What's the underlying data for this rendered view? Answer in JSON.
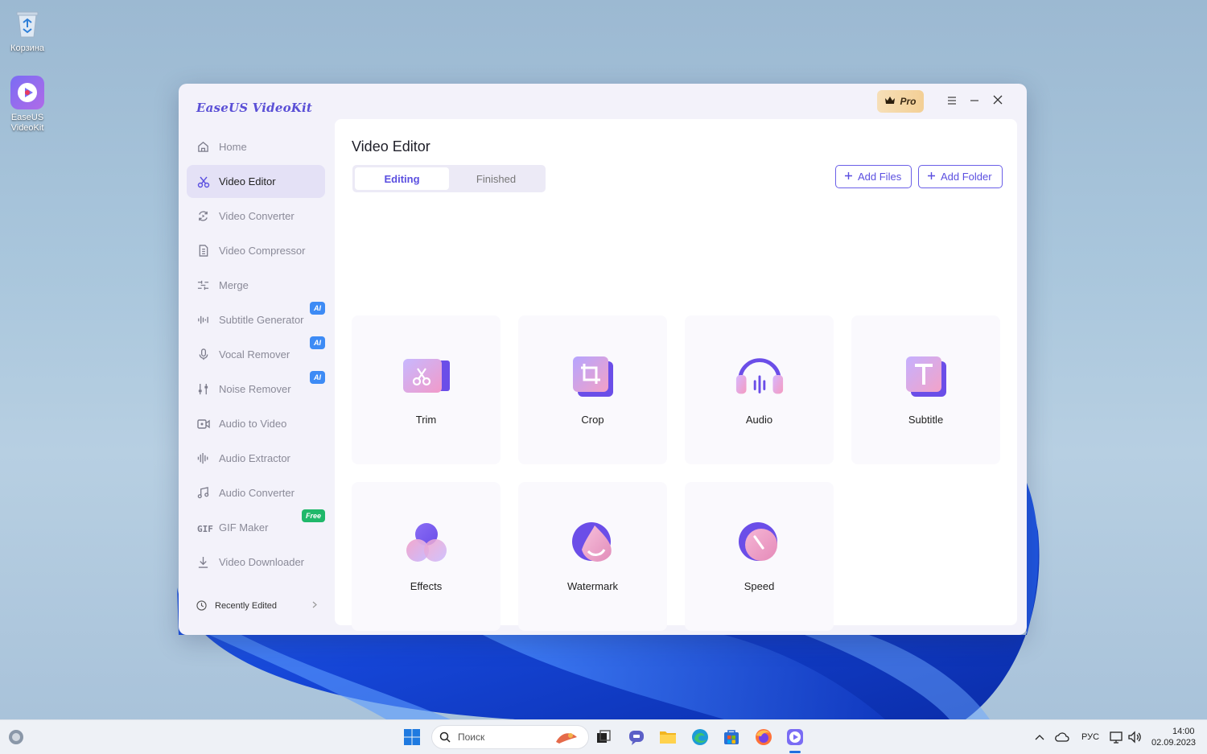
{
  "desktop": {
    "icons": [
      {
        "label": "Корзина",
        "icon": "recycle-bin-icon"
      },
      {
        "label": "EaseUS VideoKit",
        "icon": "easeus-videokit-app-icon"
      }
    ]
  },
  "window": {
    "logo": "EaseUS VideoKit",
    "pro_label": "Pro",
    "controls": [
      "menu-icon",
      "minimize-icon",
      "close-icon"
    ]
  },
  "sidebar": {
    "items": [
      {
        "label": "Home",
        "icon": "home-icon",
        "active": false
      },
      {
        "label": "Video Editor",
        "icon": "scissors-icon",
        "active": true
      },
      {
        "label": "Video Converter",
        "icon": "convert-icon",
        "active": false
      },
      {
        "label": "Video Compressor",
        "icon": "compress-icon",
        "active": false
      },
      {
        "label": "Merge",
        "icon": "merge-icon",
        "active": false
      },
      {
        "label": "Subtitle Generator",
        "icon": "waveform-icon",
        "active": false,
        "badge": "AI"
      },
      {
        "label": "Vocal Remover",
        "icon": "microphone-icon",
        "active": false,
        "badge": "AI"
      },
      {
        "label": "Noise Remover",
        "icon": "sliders-icon",
        "active": false,
        "badge": "AI"
      },
      {
        "label": "Audio to Video",
        "icon": "audio-video-icon",
        "active": false
      },
      {
        "label": "Audio Extractor",
        "icon": "audio-bars-icon",
        "active": false
      },
      {
        "label": "Audio Converter",
        "icon": "music-note-icon",
        "active": false
      },
      {
        "label": "GIF Maker",
        "icon": "gif-icon",
        "active": false,
        "badge": "Free"
      },
      {
        "label": "Video Downloader",
        "icon": "download-icon",
        "active": false
      }
    ],
    "recent_label": "Recently Edited"
  },
  "main": {
    "title": "Video Editor",
    "tabs": [
      {
        "label": "Editing",
        "active": true
      },
      {
        "label": "Finished",
        "active": false
      }
    ],
    "add_files_label": "Add Files",
    "add_folder_label": "Add Folder",
    "tools": [
      {
        "label": "Trim",
        "icon": "trim-icon"
      },
      {
        "label": "Crop",
        "icon": "crop-icon"
      },
      {
        "label": "Audio",
        "icon": "headphones-icon"
      },
      {
        "label": "Subtitle",
        "icon": "subtitle-icon"
      },
      {
        "label": "Effects",
        "icon": "effects-icon"
      },
      {
        "label": "Watermark",
        "icon": "watermark-icon"
      },
      {
        "label": "Speed",
        "icon": "speed-icon"
      }
    ]
  },
  "taskbar": {
    "search_placeholder": "Поиск",
    "language": "РУС",
    "time": "14:00",
    "date": "02.09.2023"
  },
  "colors": {
    "accent": "#5b4fe0",
    "active_nav": "#e4e1f6",
    "ai_badge": "#3d8bf5",
    "free_badge": "#1fb86a"
  }
}
